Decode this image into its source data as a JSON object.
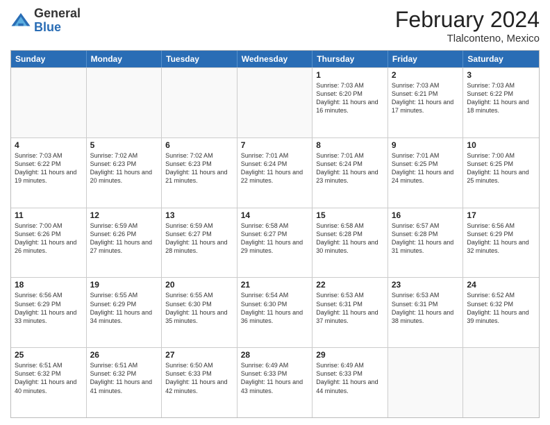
{
  "header": {
    "logo_general": "General",
    "logo_blue": "Blue",
    "month_year": "February 2024",
    "location": "Tlalconteno, Mexico"
  },
  "days_of_week": [
    "Sunday",
    "Monday",
    "Tuesday",
    "Wednesday",
    "Thursday",
    "Friday",
    "Saturday"
  ],
  "rows": [
    [
      {
        "day": "",
        "info": ""
      },
      {
        "day": "",
        "info": ""
      },
      {
        "day": "",
        "info": ""
      },
      {
        "day": "",
        "info": ""
      },
      {
        "day": "1",
        "info": "Sunrise: 7:03 AM\nSunset: 6:20 PM\nDaylight: 11 hours and 16 minutes."
      },
      {
        "day": "2",
        "info": "Sunrise: 7:03 AM\nSunset: 6:21 PM\nDaylight: 11 hours and 17 minutes."
      },
      {
        "day": "3",
        "info": "Sunrise: 7:03 AM\nSunset: 6:22 PM\nDaylight: 11 hours and 18 minutes."
      }
    ],
    [
      {
        "day": "4",
        "info": "Sunrise: 7:03 AM\nSunset: 6:22 PM\nDaylight: 11 hours and 19 minutes."
      },
      {
        "day": "5",
        "info": "Sunrise: 7:02 AM\nSunset: 6:23 PM\nDaylight: 11 hours and 20 minutes."
      },
      {
        "day": "6",
        "info": "Sunrise: 7:02 AM\nSunset: 6:23 PM\nDaylight: 11 hours and 21 minutes."
      },
      {
        "day": "7",
        "info": "Sunrise: 7:01 AM\nSunset: 6:24 PM\nDaylight: 11 hours and 22 minutes."
      },
      {
        "day": "8",
        "info": "Sunrise: 7:01 AM\nSunset: 6:24 PM\nDaylight: 11 hours and 23 minutes."
      },
      {
        "day": "9",
        "info": "Sunrise: 7:01 AM\nSunset: 6:25 PM\nDaylight: 11 hours and 24 minutes."
      },
      {
        "day": "10",
        "info": "Sunrise: 7:00 AM\nSunset: 6:25 PM\nDaylight: 11 hours and 25 minutes."
      }
    ],
    [
      {
        "day": "11",
        "info": "Sunrise: 7:00 AM\nSunset: 6:26 PM\nDaylight: 11 hours and 26 minutes."
      },
      {
        "day": "12",
        "info": "Sunrise: 6:59 AM\nSunset: 6:26 PM\nDaylight: 11 hours and 27 minutes."
      },
      {
        "day": "13",
        "info": "Sunrise: 6:59 AM\nSunset: 6:27 PM\nDaylight: 11 hours and 28 minutes."
      },
      {
        "day": "14",
        "info": "Sunrise: 6:58 AM\nSunset: 6:27 PM\nDaylight: 11 hours and 29 minutes."
      },
      {
        "day": "15",
        "info": "Sunrise: 6:58 AM\nSunset: 6:28 PM\nDaylight: 11 hours and 30 minutes."
      },
      {
        "day": "16",
        "info": "Sunrise: 6:57 AM\nSunset: 6:28 PM\nDaylight: 11 hours and 31 minutes."
      },
      {
        "day": "17",
        "info": "Sunrise: 6:56 AM\nSunset: 6:29 PM\nDaylight: 11 hours and 32 minutes."
      }
    ],
    [
      {
        "day": "18",
        "info": "Sunrise: 6:56 AM\nSunset: 6:29 PM\nDaylight: 11 hours and 33 minutes."
      },
      {
        "day": "19",
        "info": "Sunrise: 6:55 AM\nSunset: 6:29 PM\nDaylight: 11 hours and 34 minutes."
      },
      {
        "day": "20",
        "info": "Sunrise: 6:55 AM\nSunset: 6:30 PM\nDaylight: 11 hours and 35 minutes."
      },
      {
        "day": "21",
        "info": "Sunrise: 6:54 AM\nSunset: 6:30 PM\nDaylight: 11 hours and 36 minutes."
      },
      {
        "day": "22",
        "info": "Sunrise: 6:53 AM\nSunset: 6:31 PM\nDaylight: 11 hours and 37 minutes."
      },
      {
        "day": "23",
        "info": "Sunrise: 6:53 AM\nSunset: 6:31 PM\nDaylight: 11 hours and 38 minutes."
      },
      {
        "day": "24",
        "info": "Sunrise: 6:52 AM\nSunset: 6:32 PM\nDaylight: 11 hours and 39 minutes."
      }
    ],
    [
      {
        "day": "25",
        "info": "Sunrise: 6:51 AM\nSunset: 6:32 PM\nDaylight: 11 hours and 40 minutes."
      },
      {
        "day": "26",
        "info": "Sunrise: 6:51 AM\nSunset: 6:32 PM\nDaylight: 11 hours and 41 minutes."
      },
      {
        "day": "27",
        "info": "Sunrise: 6:50 AM\nSunset: 6:33 PM\nDaylight: 11 hours and 42 minutes."
      },
      {
        "day": "28",
        "info": "Sunrise: 6:49 AM\nSunset: 6:33 PM\nDaylight: 11 hours and 43 minutes."
      },
      {
        "day": "29",
        "info": "Sunrise: 6:49 AM\nSunset: 6:33 PM\nDaylight: 11 hours and 44 minutes."
      },
      {
        "day": "",
        "info": ""
      },
      {
        "day": "",
        "info": ""
      }
    ]
  ]
}
